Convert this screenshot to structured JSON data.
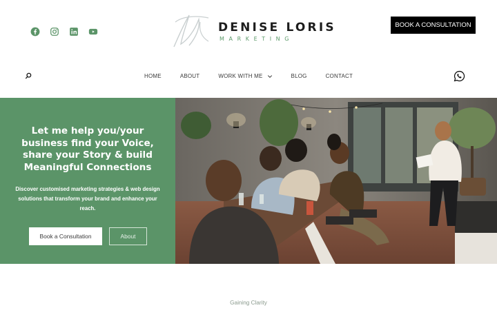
{
  "header": {
    "social_icons": [
      "facebook-icon",
      "instagram-icon",
      "linkedin-icon",
      "youtube-icon"
    ],
    "social_color": "#5b9468",
    "logo": {
      "name": "DENISE LORIS",
      "tagline": "MARKETING"
    },
    "cta_label": "BOOK A CONSULTATION"
  },
  "nav": {
    "items": [
      {
        "label": "HOME"
      },
      {
        "label": "ABOUT"
      },
      {
        "label": "WORK WITH ME",
        "has_dropdown": true
      },
      {
        "label": "BLOG"
      },
      {
        "label": "CONTACT"
      }
    ],
    "search_icon": "search-icon",
    "whatsapp_icon": "whatsapp-icon"
  },
  "hero": {
    "title": "Let me help you/your business find your Voice, share your Story & build Meaningful Connections",
    "subtitle": "Discover customised marketing strategies & web design solutions that transform your brand and enhance your reach.",
    "primary_button": "Book a Consultation",
    "secondary_button": "About",
    "accent_color": "#5b9468"
  },
  "section": {
    "label": "Gaining Clarity"
  }
}
